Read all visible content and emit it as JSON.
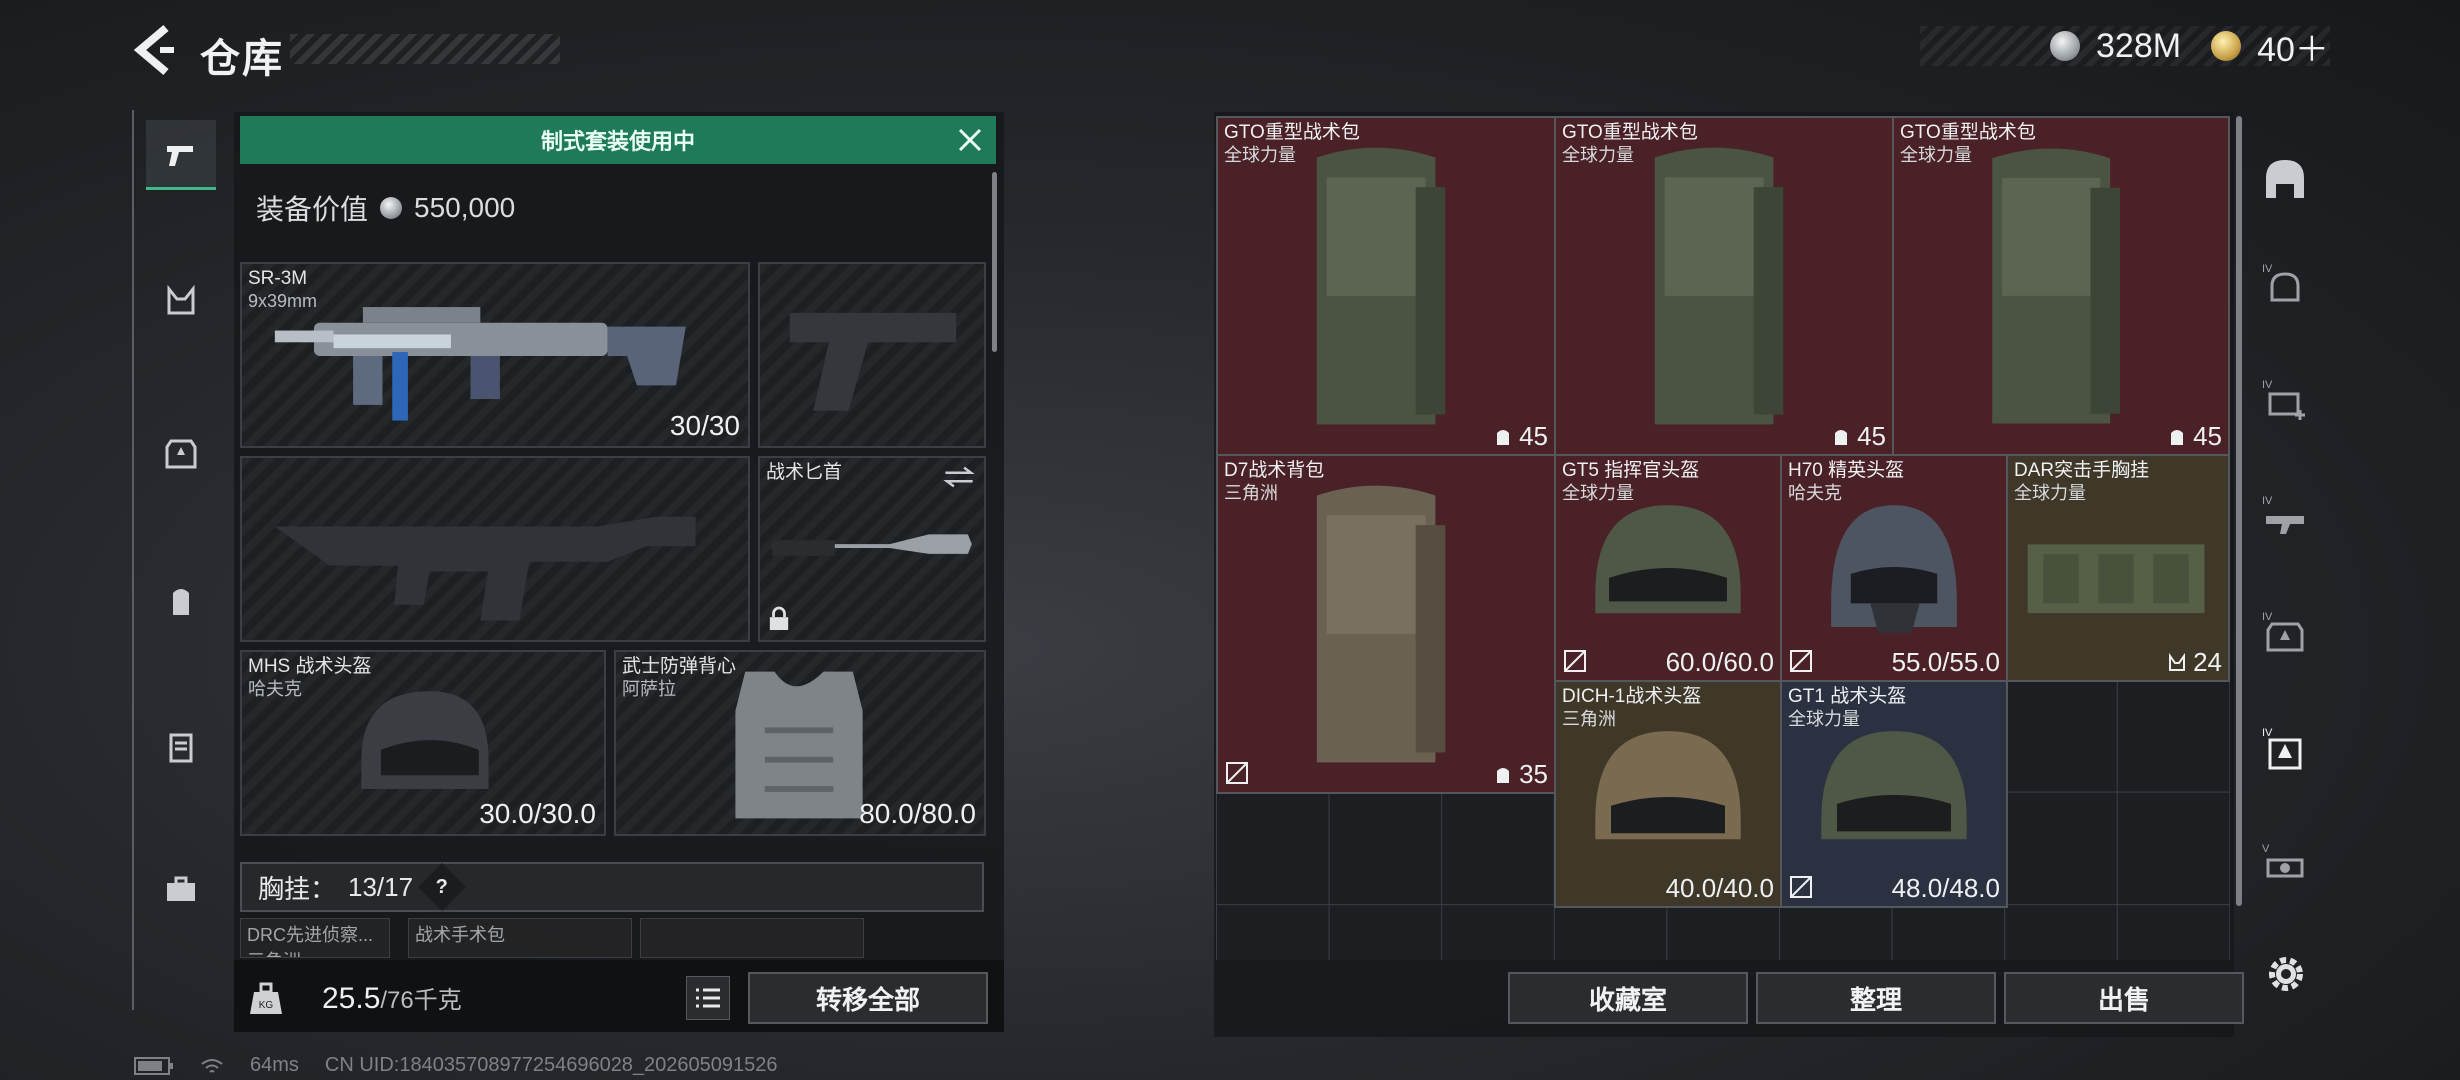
{
  "header": {
    "title": "仓库",
    "currency": [
      {
        "icon": "silver-coin-icon",
        "value": "328M"
      },
      {
        "icon": "gold-coin-icon",
        "value": "40＋"
      }
    ]
  },
  "left_rail": {
    "items": [
      "pistol-icon",
      "chest-rig-icon",
      "armor-icon",
      "backpack-icon",
      "case-icon",
      "toolbox-icon"
    ],
    "active": "pistol-icon"
  },
  "loadout": {
    "banner": "制式套装使用中",
    "value_label": "装备价值",
    "value": "550,000",
    "primary": {
      "name": "SR-3M",
      "sub": "9x39mm",
      "value": "30/30"
    },
    "knife": {
      "name": "战术匕首"
    },
    "helmet": {
      "name": "MHS 战术头盔",
      "sub": "哈夫克",
      "value": "30.0/30.0"
    },
    "armor": {
      "name": "武士防弹背心",
      "sub": "阿萨拉",
      "value": "80.0/80.0"
    },
    "chest_rig": {
      "label": "胸挂：",
      "value": "13/17",
      "help": "?"
    },
    "small_slots": [
      {
        "name": "DRC先进侦察...",
        "sub": "三角洲"
      },
      {
        "name": "战术手术包",
        "sub": ""
      },
      {
        "name": "",
        "sub": ""
      }
    ],
    "weight": {
      "current": "25.5",
      "max": "/76千克"
    },
    "transfer_all": "转移全部"
  },
  "grid": {
    "items": [
      {
        "name": "GTO重型战术包",
        "sub": "全球力量",
        "value": "45",
        "tone": "red"
      },
      {
        "name": "GTO重型战术包",
        "sub": "全球力量",
        "value": "45",
        "tone": "red"
      },
      {
        "name": "GTO重型战术包",
        "sub": "全球力量",
        "value": "45",
        "tone": "red"
      },
      {
        "name": "D7战术背包",
        "sub": "三角洲",
        "value": "35",
        "tone": "red"
      },
      {
        "name": "GT5 指挥官头盔",
        "sub": "全球力量",
        "value": "60.0/60.0",
        "tone": "red"
      },
      {
        "name": "H70 精英头盔",
        "sub": "哈夫克",
        "value": "55.0/55.0",
        "tone": "red"
      },
      {
        "name": "DAR突击手胸挂",
        "sub": "全球力量",
        "value": "24",
        "tone": "gold"
      },
      {
        "name": "DICH-1战术头盔",
        "sub": "三角洲",
        "value": "40.0/40.0",
        "tone": "gold"
      },
      {
        "name": "GT1 战术头盔",
        "sub": "全球力量",
        "value": "48.0/48.0",
        "tone": "blue"
      }
    ],
    "buttons": {
      "collection": "收藏室",
      "sort": "整理",
      "sell": "出售"
    }
  },
  "right_rail": {
    "items": [
      "storage-icon",
      "iv-helmet-icon",
      "iv-medkit-icon",
      "iv-rifle-icon",
      "iv-armor-icon",
      "iv-helmet-active-icon",
      "v-gear-icon"
    ]
  },
  "status_bar": {
    "ping": "64ms",
    "uid": "CN UID:18403570897725469602​8_202605091526"
  },
  "colors": {
    "accent": "#1f7a5a",
    "red_item": "#4a2126",
    "gold_item": "#3f3728",
    "blue_item": "#2c3142"
  }
}
